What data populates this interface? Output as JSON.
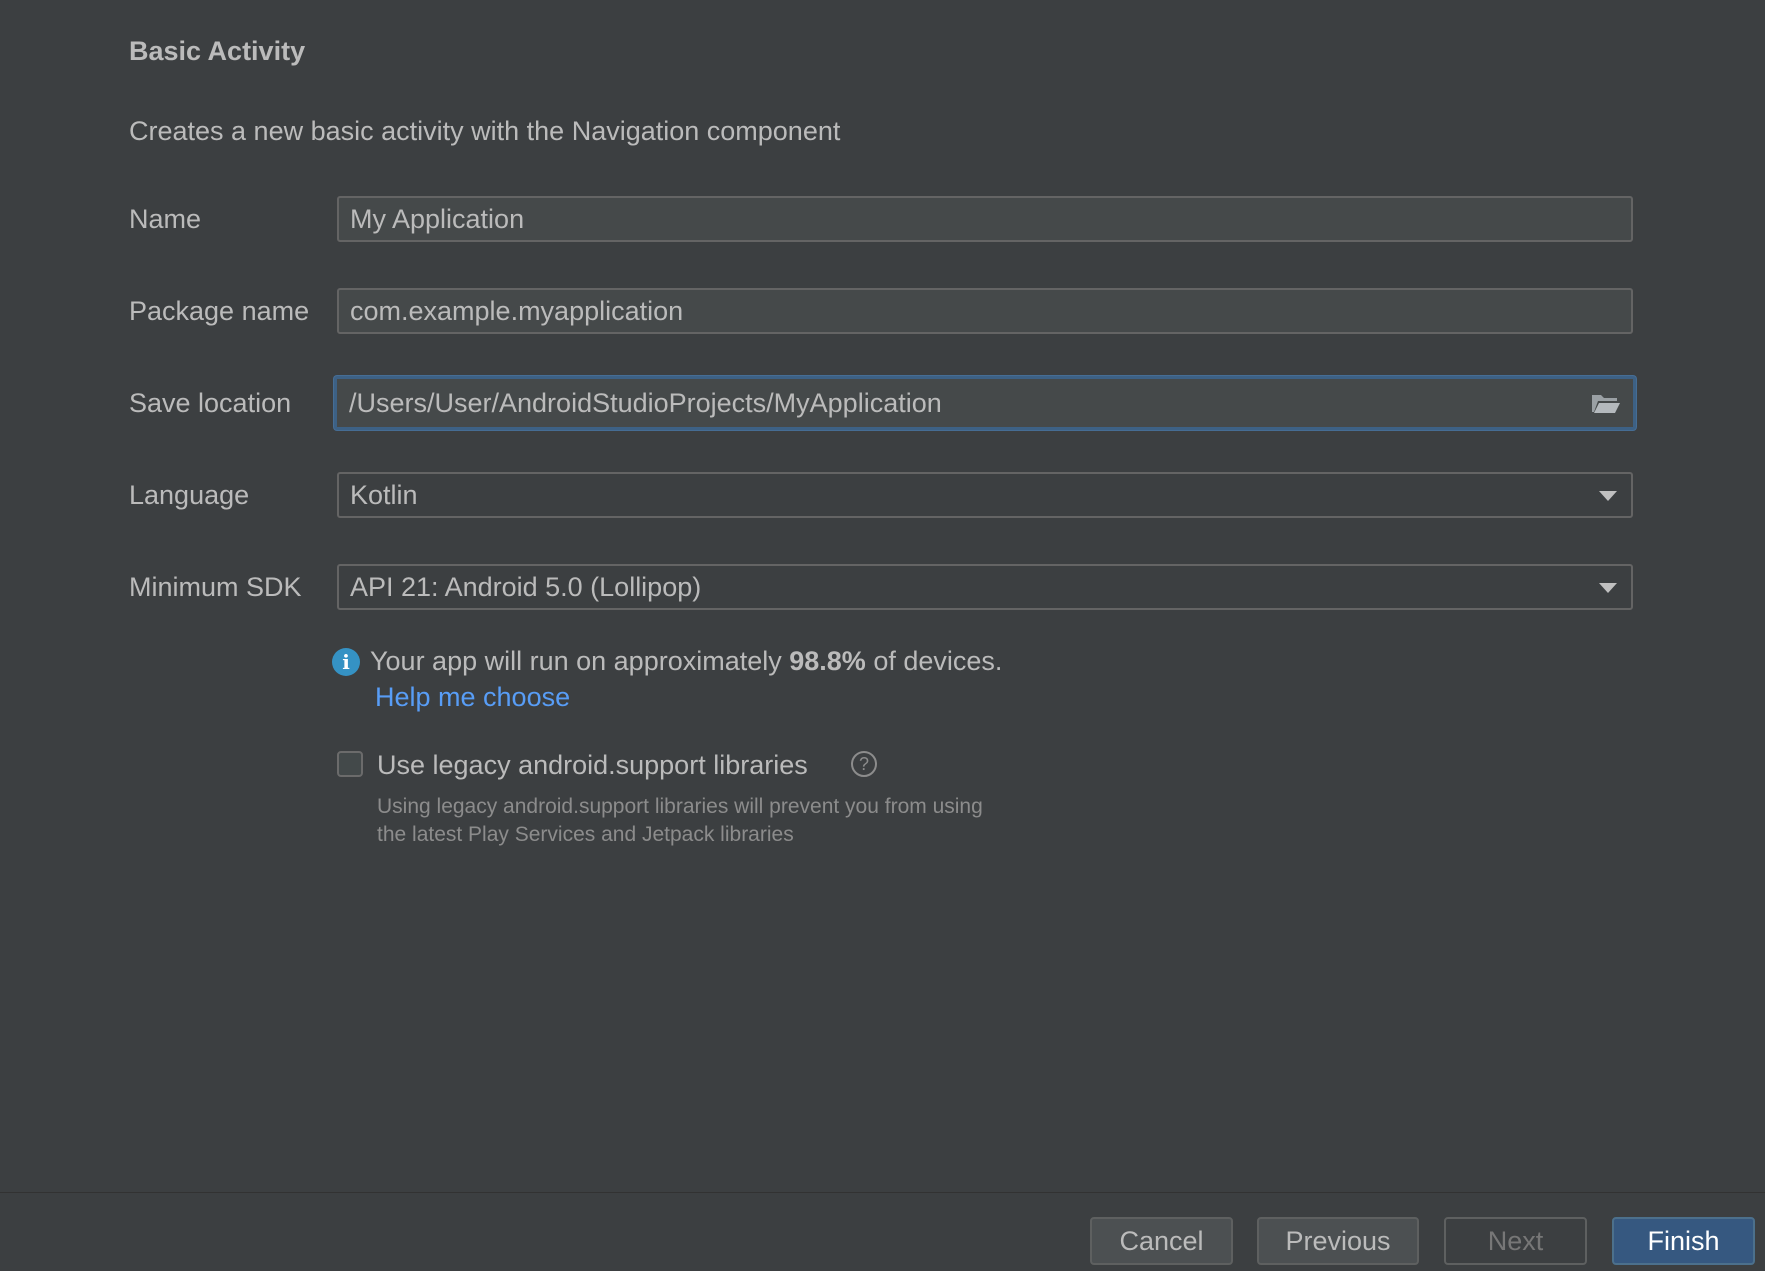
{
  "dialog": {
    "title": "Basic Activity",
    "description": "Creates a new basic activity with the Navigation component"
  },
  "form": {
    "name_label": "Name",
    "name_value": "My Application",
    "package_label": "Package name",
    "package_value": "com.example.myapplication",
    "location_label": "Save location",
    "location_value": "/Users/User/AndroidStudioProjects/MyApplication",
    "language_label": "Language",
    "language_value": "Kotlin",
    "sdk_label": "Minimum SDK",
    "sdk_value": "API 21: Android 5.0 (Lollipop)"
  },
  "info": {
    "prefix": "Your app will run on approximately ",
    "percent": "98.8%",
    "suffix": " of devices.",
    "help_link": "Help me choose"
  },
  "legacy": {
    "checkbox_label": "Use legacy android.support libraries",
    "checked": false,
    "hint_line1": "Using legacy android.support libraries will prevent you from using",
    "hint_line2": "the latest Play Services and Jetpack libraries"
  },
  "buttons": {
    "cancel": "Cancel",
    "previous": "Previous",
    "next": "Next",
    "finish": "Finish"
  },
  "colors": {
    "background": "#3c3f41",
    "accent": "#365880",
    "link": "#589df6",
    "info_icon": "#3592c4"
  }
}
